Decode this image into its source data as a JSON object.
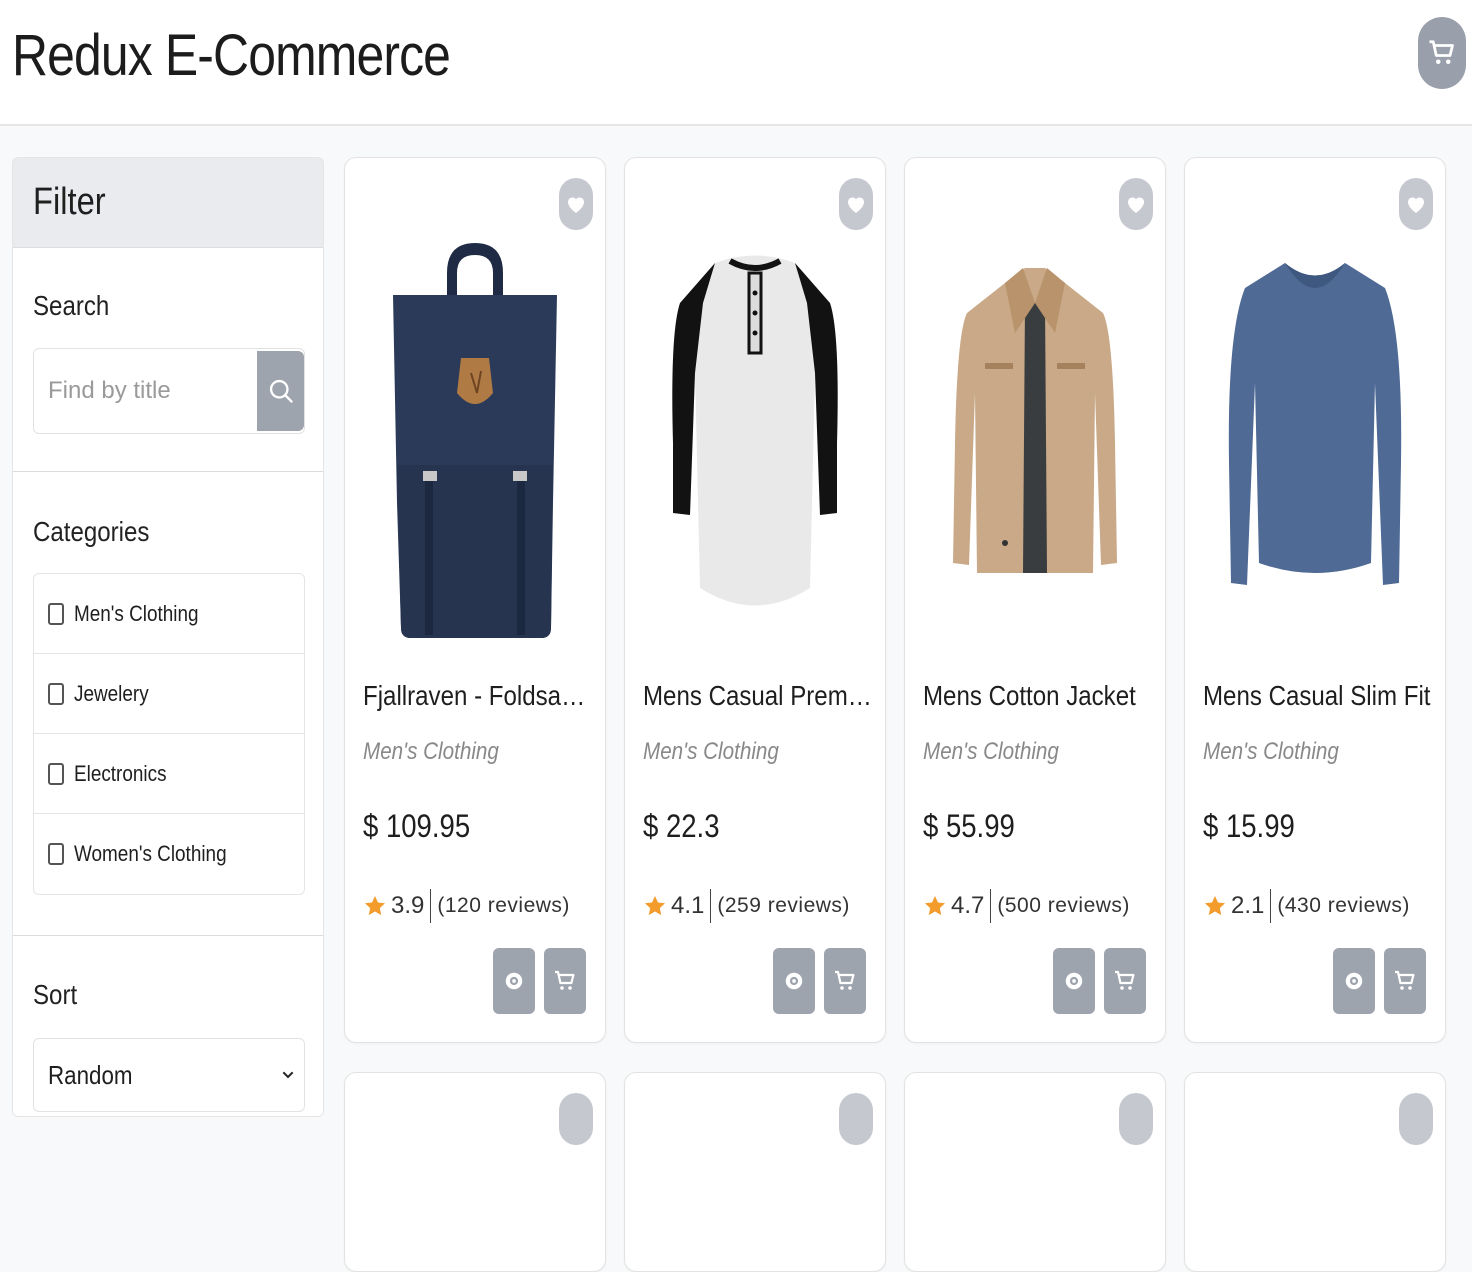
{
  "header": {
    "title": "Redux E-Commerce",
    "cart_icon": "cart-icon"
  },
  "sidebar": {
    "heading": "Filter",
    "search": {
      "label": "Search",
      "placeholder": "Find by title",
      "value": ""
    },
    "categories": {
      "label": "Categories",
      "items": [
        {
          "label": "Men's Clothing",
          "checked": false
        },
        {
          "label": "Jewelery",
          "checked": false
        },
        {
          "label": "Electronics",
          "checked": false
        },
        {
          "label": "Women's Clothing",
          "checked": false
        }
      ]
    },
    "sort": {
      "label": "Sort",
      "selected": "Random"
    }
  },
  "colors": {
    "button_gray": "#9ea4ae",
    "star": "#f39c2b",
    "accent_text": "#1e1e1e"
  },
  "products": [
    {
      "title": "Fjallraven - Foldsack N...",
      "category": "Men's Clothing",
      "price": "$ 109.95",
      "rating": "3.9",
      "reviews": "(120 reviews)",
      "image_icon": "backpack"
    },
    {
      "title": "Mens Casual Premium...",
      "category": "Men's Clothing",
      "price": "$ 22.3",
      "rating": "4.1",
      "reviews": "(259 reviews)",
      "image_icon": "raglan-shirt"
    },
    {
      "title": "Mens Cotton Jacket",
      "category": "Men's Clothing",
      "price": "$ 55.99",
      "rating": "4.7",
      "reviews": "(500 reviews)",
      "image_icon": "jacket"
    },
    {
      "title": "Mens Casual Slim Fit",
      "category": "Men's Clothing",
      "price": "$ 15.99",
      "rating": "2.1",
      "reviews": "(430 reviews)",
      "image_icon": "long-sleeve-shirt"
    }
  ]
}
